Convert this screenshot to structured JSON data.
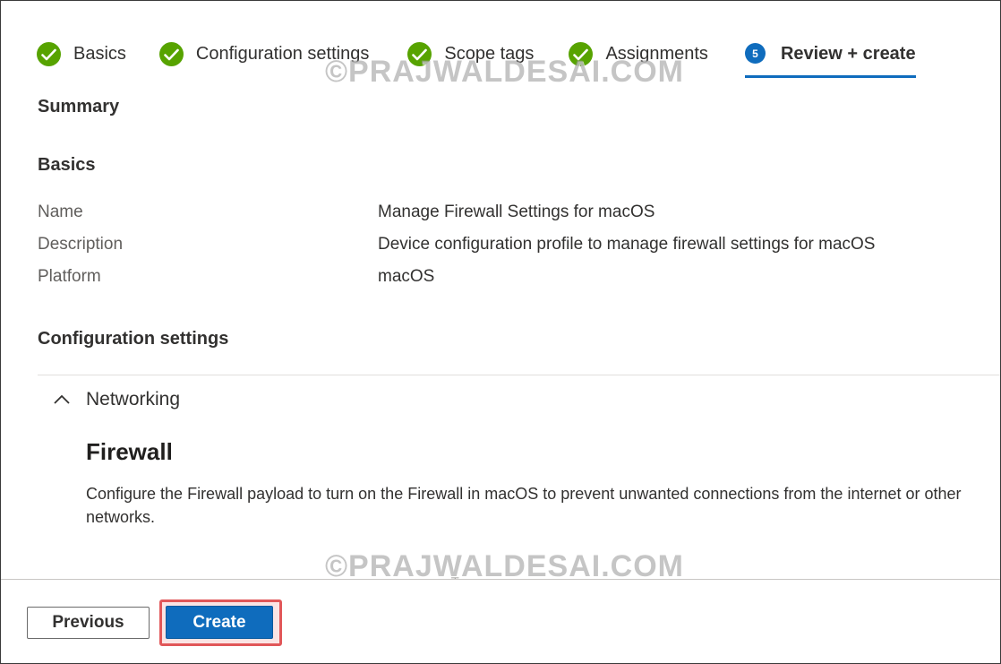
{
  "wizard": {
    "steps": [
      {
        "label": "Basics",
        "state": "completed",
        "icon": "checkmark-circle-icon"
      },
      {
        "label": "Configuration settings",
        "state": "completed",
        "icon": "checkmark-circle-icon"
      },
      {
        "label": "Scope tags",
        "state": "completed",
        "icon": "checkmark-circle-icon"
      },
      {
        "label": "Assignments",
        "state": "completed",
        "icon": "checkmark-circle-icon"
      },
      {
        "label": "Review + create",
        "state": "active",
        "number": "5"
      }
    ]
  },
  "watermark": "©PRAJWALDESAI.COM",
  "summary": {
    "title": "Summary",
    "basics": {
      "title": "Basics",
      "rows": [
        {
          "label": "Name",
          "value": "Manage Firewall Settings for macOS"
        },
        {
          "label": "Description",
          "value": "Device configuration profile to manage firewall settings for macOS"
        },
        {
          "label": "Platform",
          "value": "macOS"
        }
      ]
    },
    "configuration": {
      "title": "Configuration settings",
      "section": {
        "label": "Networking",
        "expanded": true,
        "icon": "chevron-up-icon",
        "firewall_title": "Firewall",
        "firewall_description": "Configure the Firewall payload to turn on the Firewall in macOS to prevent unwanted connections from the internet or other networks."
      }
    }
  },
  "footer": {
    "previous_label": "Previous",
    "create_label": "Create"
  },
  "colors": {
    "accent": "#0f6cbd",
    "success": "#57a300",
    "highlight": "#e15759"
  }
}
